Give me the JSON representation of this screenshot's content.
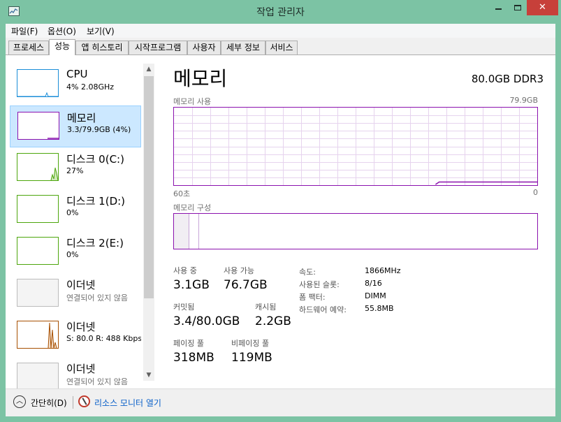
{
  "window": {
    "title": "작업 관리자"
  },
  "menu": [
    "파일(F)",
    "옵션(O)",
    "보기(V)"
  ],
  "tabs": [
    "프로세스",
    "성능",
    "앱 히스토리",
    "시작프로그램",
    "사용자",
    "세부 정보",
    "서비스"
  ],
  "active_tab": "성능",
  "sidebar": {
    "items": [
      {
        "title": "CPU",
        "sub": "4% 2.08GHz",
        "color": "#1a8dd8"
      },
      {
        "title": "메모리",
        "sub": "3.3/79.9GB (4%)",
        "color": "#8b12ae"
      },
      {
        "title": "디스크 0(C:)",
        "sub": "27%",
        "color": "#4da60c"
      },
      {
        "title": "디스크 1(D:)",
        "sub": "0%",
        "color": "#4da60c"
      },
      {
        "title": "디스크 2(E:)",
        "sub": "0%",
        "color": "#4da60c"
      },
      {
        "title": "이더넷",
        "sub": "연결되어 있지 않음",
        "color": "#bbbbbb"
      },
      {
        "title": "이더넷",
        "sub": "S: 80.0 R: 488 Kbps",
        "color": "#a74f01"
      },
      {
        "title": "이더넷",
        "sub": "연결되어 있지 않음",
        "color": "#bbbbbb"
      }
    ]
  },
  "main": {
    "title": "메모리",
    "spec": "80.0GB DDR3",
    "usage_label": "메모리 사용",
    "usage_max": "79.9GB",
    "time_left": "60초",
    "time_right": "0",
    "composition_label": "메모리 구성",
    "usage_fraction": 0.04
  },
  "stats": {
    "in_use_label": "사용 중",
    "in_use": "3.1GB",
    "available_label": "사용 가능",
    "available": "76.7GB",
    "committed_label": "커밋됨",
    "committed": "3.4/80.0GB",
    "cached_label": "캐시됨",
    "cached": "2.2GB",
    "paged_label": "페이징 풀",
    "paged": "318MB",
    "nonpaged_label": "비페이징 풀",
    "nonpaged": "119MB"
  },
  "props": [
    {
      "label": "속도:",
      "value": "1866MHz"
    },
    {
      "label": "사용된 슬롯:",
      "value": "8/16"
    },
    {
      "label": "폼 팩터:",
      "value": "DIMM"
    },
    {
      "label": "하드웨어 예약:",
      "value": "55.8MB"
    }
  ],
  "footer": {
    "fewer": "간단히(D)",
    "resmon": "리소스 모니터 열기"
  },
  "colors": {
    "accent": "#8b12ae",
    "titlebar": "#7cc3a4",
    "close": "#c7403a",
    "link": "#0a60c9"
  }
}
